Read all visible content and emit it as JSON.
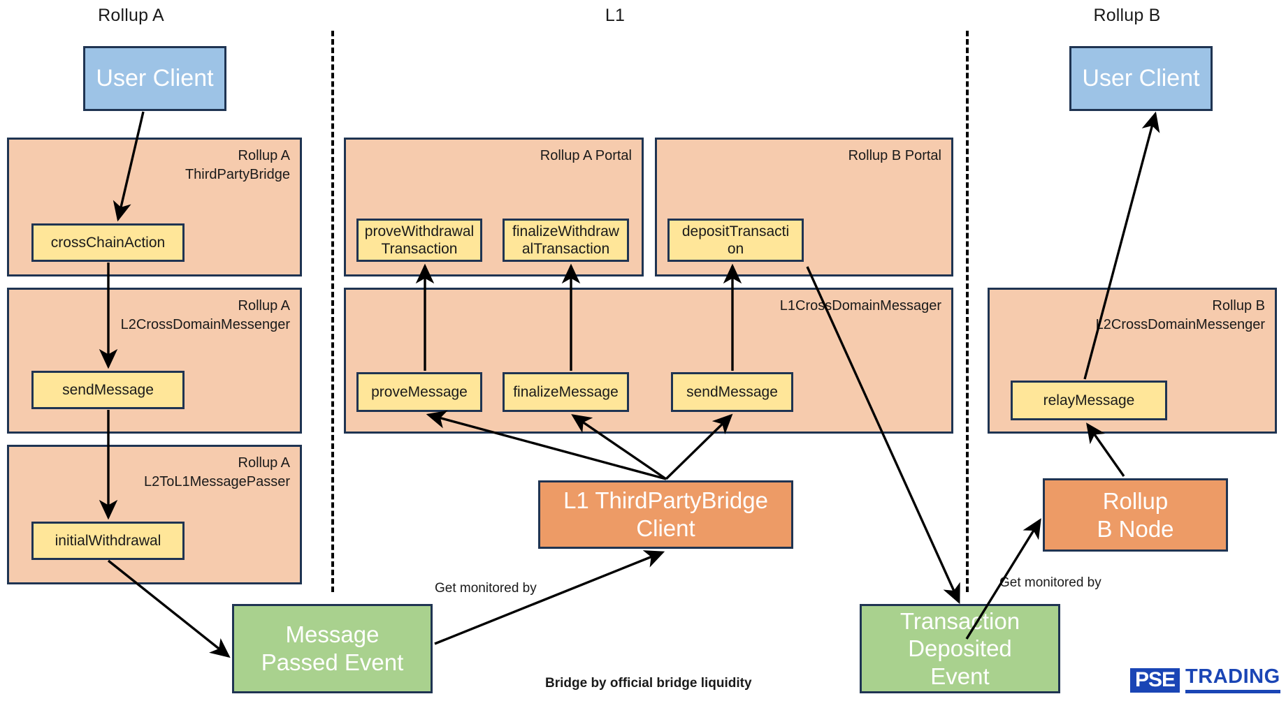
{
  "lanes": [
    {
      "label": "Rollup A"
    },
    {
      "label": "L1"
    },
    {
      "label": "Rollup B"
    }
  ],
  "rollup_a": {
    "user_client": "User Client",
    "third_party_bridge": {
      "title": "Rollup A\nThirdPartyBridge",
      "fn": "crossChainAction"
    },
    "l2_cross_domain_messenger": {
      "title": "Rollup A\nL2CrossDomainMessenger",
      "fn": "sendMessage"
    },
    "l2_to_l1_message_passer": {
      "title": "Rollup A\nL2ToL1MessagePasser",
      "fn": "initialWithdrawal"
    }
  },
  "l1": {
    "rollup_a_portal": {
      "title": "Rollup A Portal",
      "fns": [
        "proveWithdrawal\nTransaction",
        "finalizeWithdraw\nalTransaction"
      ]
    },
    "rollup_b_portal": {
      "title": "Rollup B Portal",
      "fns": [
        "depositTransacti\non"
      ]
    },
    "l1_cross_domain_messenger": {
      "title": "L1CrossDomainMessager",
      "fns": [
        "proveMessage",
        "finalizeMessage",
        "sendMessage"
      ]
    },
    "client": "L1 ThirdPartyBridge\nClient",
    "caption": "Bridge by official bridge liquidity"
  },
  "rollup_b": {
    "user_client": "User Client",
    "l2_cross_domain_messenger": {
      "title": "Rollup B\nL2CrossDomainMessenger",
      "fn": "relayMessage"
    },
    "node": "Rollup\nB Node"
  },
  "events": {
    "message_passed": "Message\nPassed Event",
    "transaction_deposited": "Transaction\nDeposited\nEvent"
  },
  "edge_labels": {
    "monitored_left": "Get monitored by",
    "monitored_right": "Get monitored by"
  },
  "logo": {
    "mark": "PSE",
    "word": "TRADING"
  },
  "colors": {
    "container": "#f6cbad",
    "function": "#ffe699",
    "client_blue": "#9dc3e6",
    "event_green": "#a9d18e",
    "node_orange": "#ed9b66",
    "stroke": "#1f3452",
    "logo_blue": "#1a45b5"
  }
}
